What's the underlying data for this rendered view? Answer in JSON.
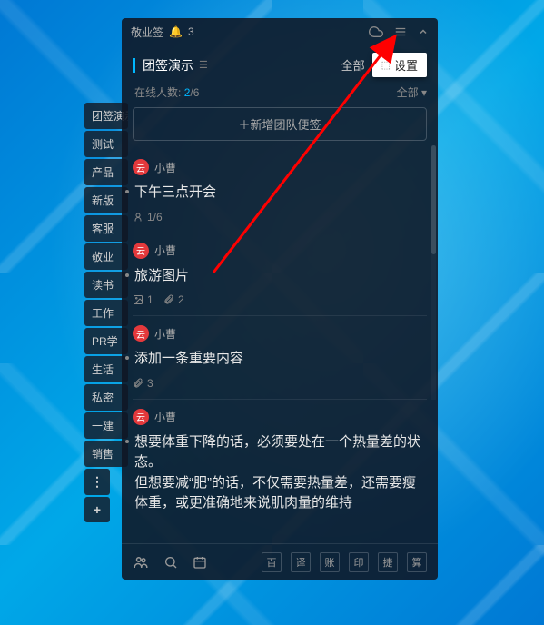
{
  "titlebar": {
    "app_name": "敬业签",
    "notification_count": "3"
  },
  "header": {
    "section_title": "团签演示",
    "all_label": "全部",
    "settings_label": "设置"
  },
  "online": {
    "label": "在线人数:",
    "active": "2",
    "total": "/6",
    "all_dropdown": "全部 ▾"
  },
  "add_button": "＋新增团队便签",
  "sidebar": {
    "tabs": [
      "团签演示",
      "测试",
      "产品",
      "新版",
      "客服",
      "敬业",
      "读书",
      "工作",
      "PR学",
      "生活",
      "私密",
      "一建",
      "销售"
    ],
    "more": "⋮",
    "plus": "+"
  },
  "notes": [
    {
      "avatar_letter": "云",
      "author": "小曹",
      "content": "下午三点开会",
      "meta_icon": "person",
      "meta_text": "1/6"
    },
    {
      "avatar_letter": "云",
      "author": "小曹",
      "content": "旅游图片",
      "meta_icon": "image",
      "meta_text": "1",
      "meta_attach": "2"
    },
    {
      "avatar_letter": "云",
      "author": "小曹",
      "content": "添加一条重要内容",
      "meta_icon": "attach",
      "meta_text": "3"
    },
    {
      "avatar_letter": "云",
      "author": "小曹",
      "content": "想要体重下降的话，必须要处在一个热量差的状态。\n但想要减“肥”的话，不仅需要热量差，还需要瘦体重，或更准确地来说肌肉量的维持"
    }
  ],
  "bottom": {
    "right_buttons": [
      "百",
      "译",
      "账",
      "印",
      "捷",
      "算"
    ]
  }
}
